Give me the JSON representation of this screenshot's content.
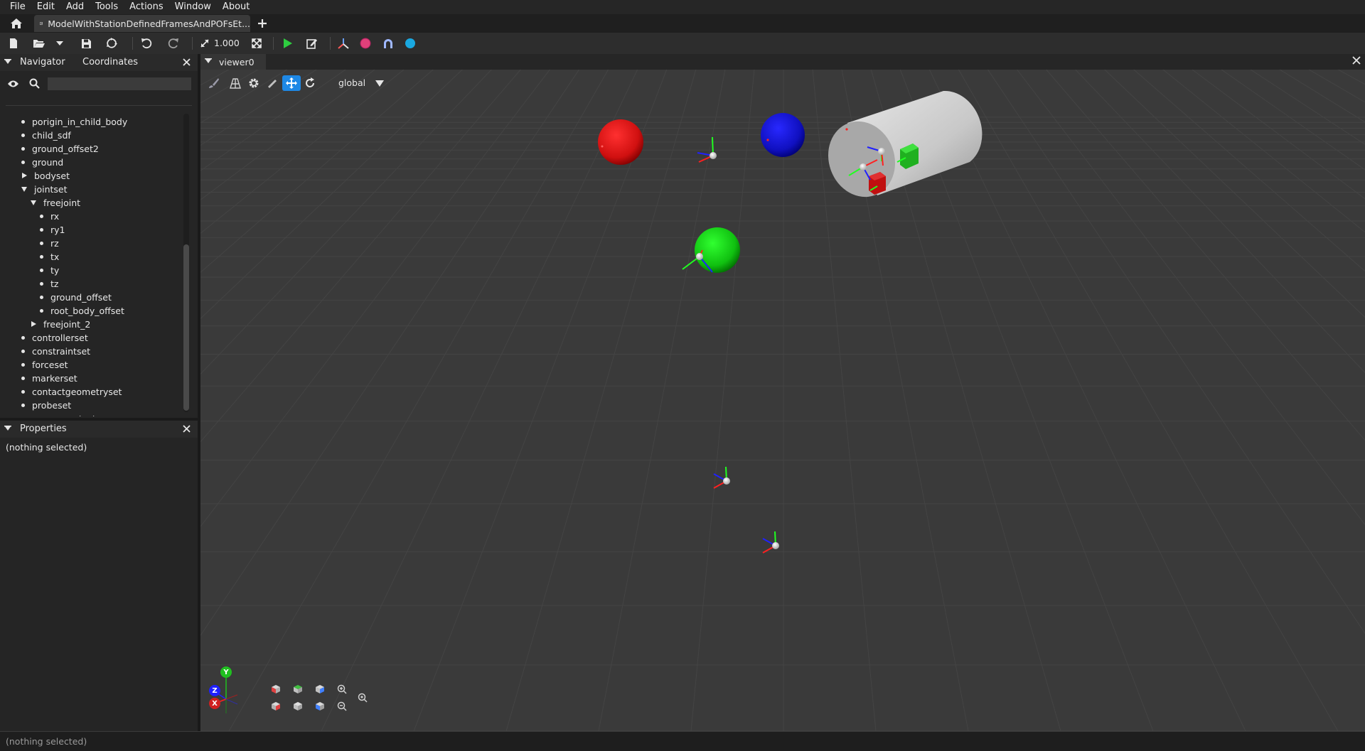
{
  "menu": [
    "File",
    "Edit",
    "Add",
    "Tools",
    "Actions",
    "Window",
    "About"
  ],
  "tabs": {
    "document_title": "ModelWithStationDefinedFramesAndPOFsEt..."
  },
  "toolbar": {
    "scale_value": "1.000"
  },
  "navigator": {
    "tab_navigator": "Navigator",
    "tab_coordinates": "Coordinates",
    "search_value": "",
    "items": [
      {
        "label": "porigin_in_child_body",
        "kind": "leaf",
        "level": 0
      },
      {
        "label": "child_sdf",
        "kind": "leaf",
        "level": 0
      },
      {
        "label": "ground_offset2",
        "kind": "leaf",
        "level": 0
      },
      {
        "label": "ground",
        "kind": "leaf",
        "level": 0
      },
      {
        "label": "bodyset",
        "kind": "collapsed",
        "level": 0
      },
      {
        "label": "jointset",
        "kind": "expanded",
        "level": 0
      },
      {
        "label": "freejoint",
        "kind": "expanded",
        "level": 1
      },
      {
        "label": "rx",
        "kind": "leaf",
        "level": 2
      },
      {
        "label": "ry1",
        "kind": "leaf",
        "level": 2
      },
      {
        "label": "rz",
        "kind": "leaf",
        "level": 2
      },
      {
        "label": "tx",
        "kind": "leaf",
        "level": 2
      },
      {
        "label": "ty",
        "kind": "leaf",
        "level": 2
      },
      {
        "label": "tz",
        "kind": "leaf",
        "level": 2
      },
      {
        "label": "ground_offset",
        "kind": "leaf",
        "level": 2
      },
      {
        "label": "root_body_offset",
        "kind": "leaf",
        "level": 2
      },
      {
        "label": "freejoint_2",
        "kind": "collapsed",
        "level": 1
      },
      {
        "label": "controllerset",
        "kind": "leaf",
        "level": 0
      },
      {
        "label": "constraintset",
        "kind": "leaf",
        "level": 0
      },
      {
        "label": "forceset",
        "kind": "leaf",
        "level": 0
      },
      {
        "label": "markerset",
        "kind": "leaf",
        "level": 0
      },
      {
        "label": "contactgeometryset",
        "kind": "leaf",
        "level": 0
      },
      {
        "label": "probeset",
        "kind": "leaf",
        "level": 0
      },
      {
        "label": "componentset",
        "kind": "leaf",
        "level": 0
      }
    ]
  },
  "properties": {
    "title": "Properties",
    "empty_text": "(nothing selected)"
  },
  "viewer": {
    "tab_label": "viewer0",
    "frame_label": "global"
  },
  "axes_gizmo": {
    "y": "Y",
    "z": "Z",
    "x": "X"
  },
  "status": {
    "text": "(nothing selected)"
  },
  "colors": {
    "accent": "#1e88e5",
    "sphere_red": "#d01010",
    "sphere_blue": "#1010c0",
    "sphere_green": "#10c010",
    "simulate_green": "#2ecc40"
  }
}
